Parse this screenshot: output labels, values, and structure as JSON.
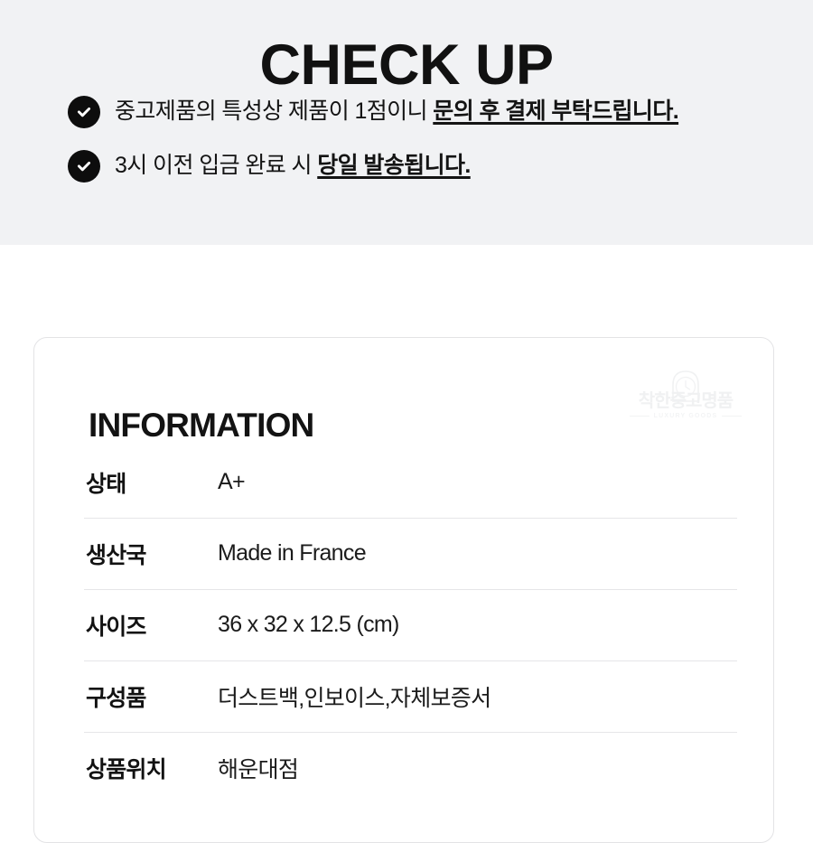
{
  "checkup": {
    "title": "CHECK UP",
    "icon": "check-circle-icon",
    "items": [
      {
        "plain": "중고제품의 특성상 제품이 1점이니 ",
        "emphasis": "문의 후 결제 부탁드립니다."
      },
      {
        "plain": "3시 이전 입금 완료 시 ",
        "emphasis": "당일 발송됩니다."
      }
    ]
  },
  "information": {
    "title": "INFORMATION",
    "watermark": {
      "icon": "shop-clock-logo-icon",
      "name": "착한중고명품",
      "subtitle": "LUXURY GOODS"
    },
    "rows": [
      {
        "label": "상태",
        "value": "A+"
      },
      {
        "label": "생산국",
        "value": "Made in France"
      },
      {
        "label": "사이즈",
        "value": "36 x 32 x 12.5 (cm)"
      },
      {
        "label": "구성품",
        "value": "더스트백,인보이스,자체보증서"
      },
      {
        "label": "상품위치",
        "value": "해운대점"
      }
    ]
  },
  "colors": {
    "banner_background": "#f1f2f4",
    "page_background": "#ffffff",
    "text": "#131313",
    "icon_fill": "#0d0d0d",
    "card_border": "#e3e3e5",
    "row_divider": "#e6e6e8"
  }
}
